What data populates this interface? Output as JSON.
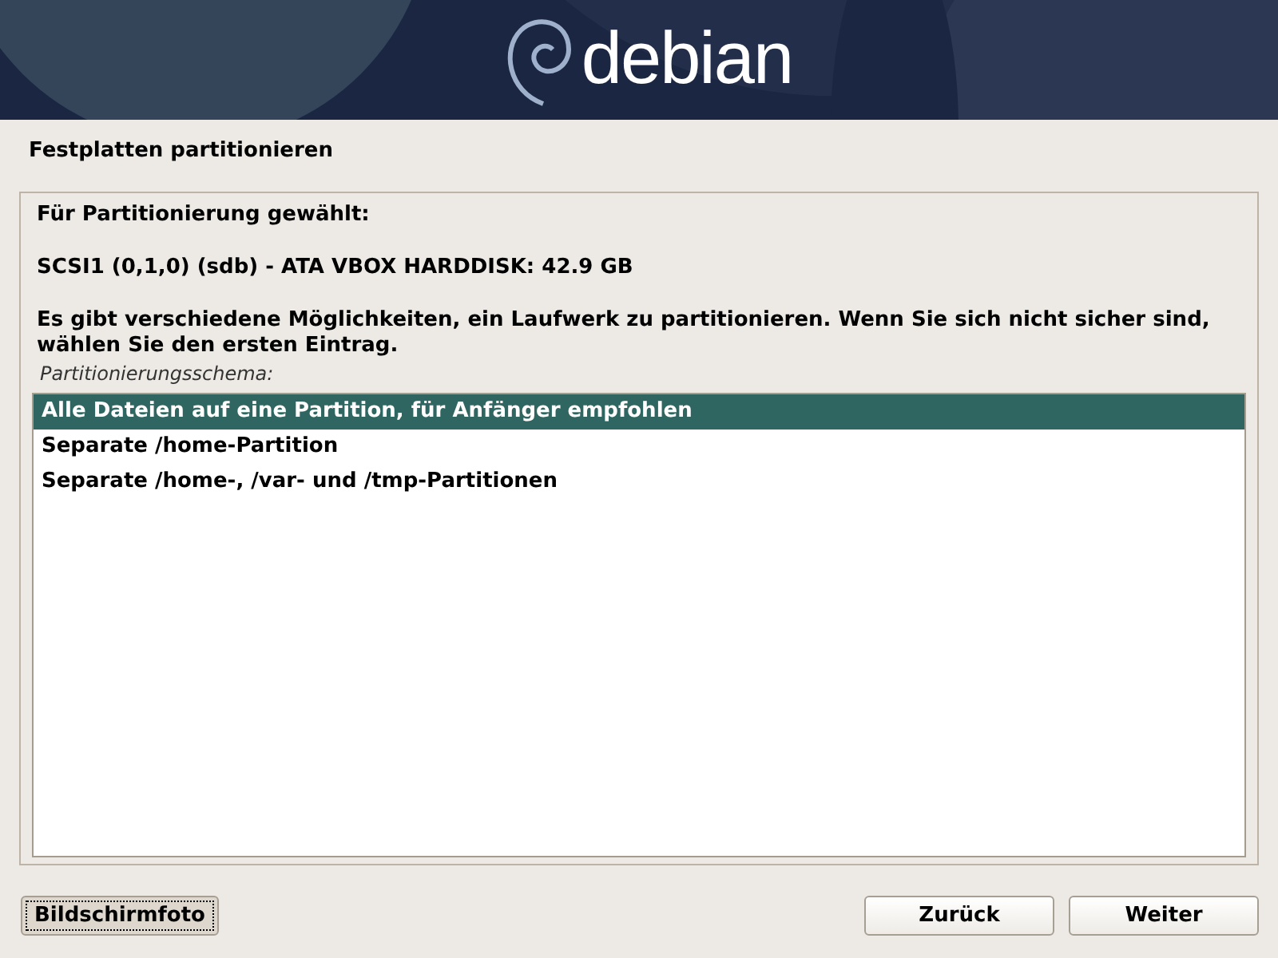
{
  "banner": {
    "logo_text": "debian"
  },
  "title": "Festplatten partitionieren",
  "info": [
    {
      "text": "Für Partitionierung gewählt:"
    },
    {
      "text": "SCSI1 (0,1,0) (sdb) - ATA VBOX HARDDISK: 42.9 GB"
    },
    {
      "text": "Es gibt verschiedene Möglichkeiten, ein Laufwerk zu partitionieren. Wenn Sie sich nicht sicher sind, wählen Sie den ersten Eintrag."
    }
  ],
  "list_label": "Partitionierungsschema:",
  "options": [
    {
      "label": "Alle Dateien auf eine Partition, für Anfänger empfohlen",
      "selected": true
    },
    {
      "label": "Separate /home-Partition",
      "selected": false
    },
    {
      "label": "Separate /home-, /var- und /tmp-Partitionen",
      "selected": false
    }
  ],
  "buttons": {
    "screenshot": {
      "label": "Bildschirmfoto",
      "focused": true
    },
    "back": {
      "label": "Zurück"
    },
    "next": {
      "label": "Weiter"
    }
  }
}
